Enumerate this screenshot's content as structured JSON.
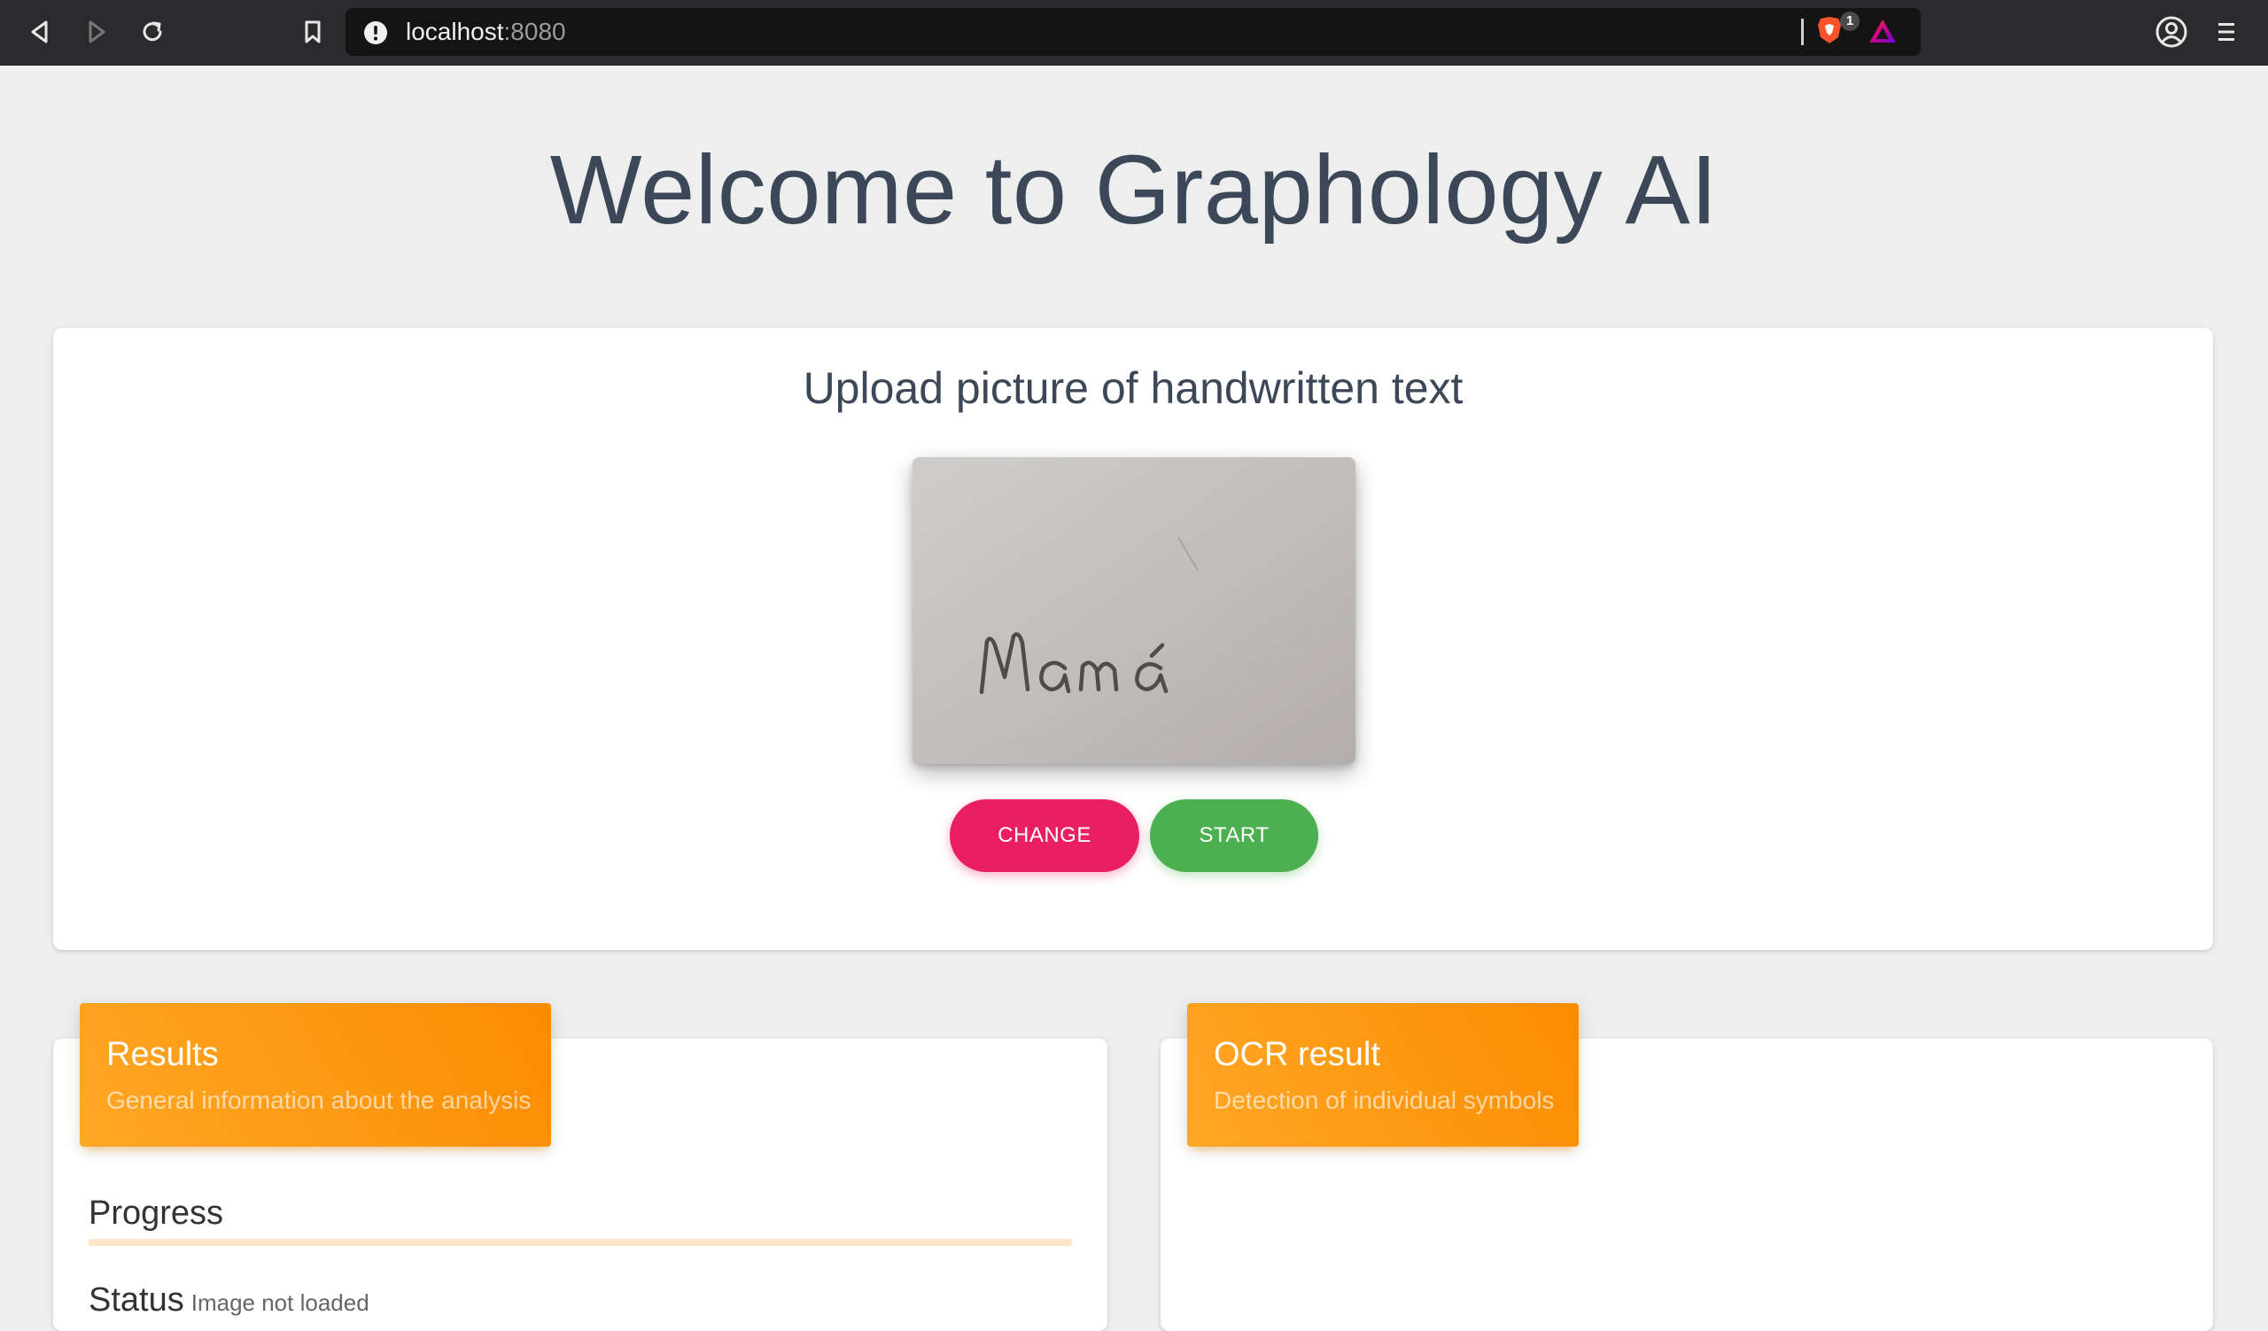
{
  "browser": {
    "url_host": "localhost",
    "url_port": ":8080",
    "shields_badge": "1"
  },
  "page": {
    "title": "Welcome to Graphology AI"
  },
  "upload": {
    "title": "Upload picture of handwritten text",
    "image_text": "Mama",
    "change_label": "CHANGE",
    "start_label": "START",
    "colors": {
      "change": "#e91e63",
      "start": "#4caf50"
    }
  },
  "results": {
    "title": "Results",
    "subtitle": "General information about the analysis",
    "progress_label": "Progress",
    "progress_value": 0,
    "status_label": "Status",
    "status_value": "Image not loaded"
  },
  "ocr": {
    "title": "OCR result",
    "subtitle": "Detection of individual symbols"
  },
  "theme": {
    "header_accent": "#fb8c00",
    "page_background": "#eeeeee",
    "title_color": "#3c4858"
  }
}
